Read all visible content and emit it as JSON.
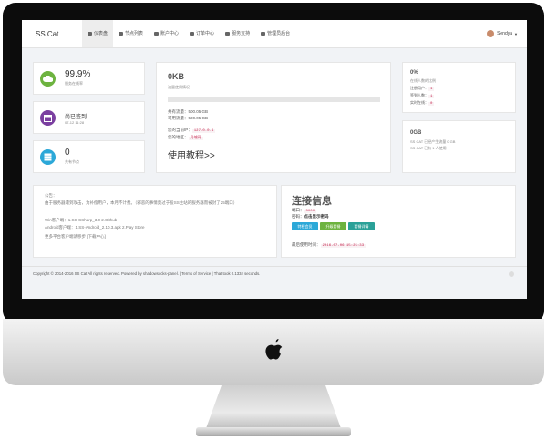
{
  "header": {
    "brand": "SS Cat",
    "nav": [
      "仪表盘",
      "节点列表",
      "账户中心",
      "订单中心",
      "服务支持",
      "管理员后台"
    ],
    "user": "Sendya"
  },
  "stats": [
    {
      "value": "99.9%",
      "label": "服务在线率",
      "color": "#6db33f",
      "icon": "cloud-icon"
    },
    {
      "value": "尚已签到",
      "label": "07-12 11:28",
      "color": "#7b3fa0",
      "icon": "calendar-icon"
    },
    {
      "value": "0",
      "label": "共有节点",
      "color": "#2ca8d8",
      "icon": "server-icon"
    }
  ],
  "traffic": {
    "used": "0KB",
    "used_label": "流量使用情况",
    "progress": 0,
    "total": "共有流量：500.05 GB",
    "available": "可用流量：500.05 GB",
    "ip_label": "您的当前IP：",
    "ip": "127.0.0.1",
    "region_label": "您的地区：",
    "region": "局域网",
    "tutorial": "使用教程>>"
  },
  "online": {
    "percent": "0%",
    "title": "在线人数的比例",
    "rows": [
      {
        "label": "注册用户：",
        "value": "1"
      },
      {
        "label": "签到人数：",
        "value": "1"
      },
      {
        "label": "实时在线：",
        "value": "0"
      }
    ]
  },
  "total_traffic": {
    "value": "0GB",
    "line1": "SS CAT 已经产生流量 0 GB",
    "line2": "SS CAT 已有 1 人使用"
  },
  "notice": {
    "title": "公告：",
    "lines": [
      "由于服务器遭到攻击，为补偿用户，本月不计费。（邪恶的事情莫过于投SS主站的服务器而被封了25端口）",
      "Win客户端：1.SS-CSharp_3.0   2.Github",
      "Android客户端：1.SS-Android_2.10.3.apk   2.Play Store",
      "更多平台客户端请移步 [下载中心]"
    ]
  },
  "connection": {
    "title": "连接信息",
    "port_label": "端口：",
    "port": "5000",
    "pwd_label": "密码：",
    "pwd": "点击显示密码",
    "buttons": [
      {
        "label": "特权会员",
        "color": "#2ca8d8"
      },
      {
        "label": "升级套餐",
        "color": "#6db33f"
      },
      {
        "label": "套餐详情",
        "color": "#2aa198"
      }
    ],
    "last_used_label": "最后使用时间：",
    "last_used": "2016-07-06 15:25:33"
  },
  "footer": {
    "text": "Copyright © 2014-2016 SS Cat All rights reserved. Powered by shadowsocks-panel. | Terms of Service | That took 0.1334 seconds."
  }
}
